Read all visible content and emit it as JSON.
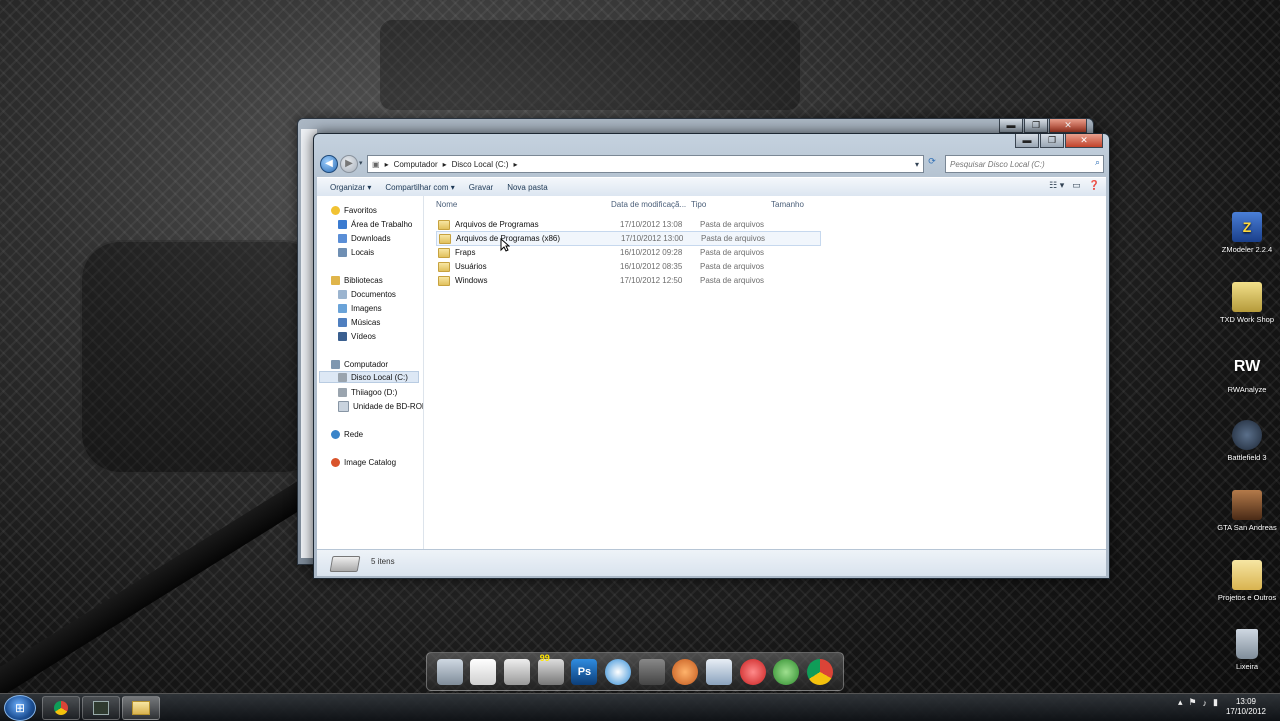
{
  "window": {
    "caption": {
      "minimize": "▬",
      "maximize": "❐",
      "close": "✕"
    }
  },
  "address": {
    "crumbs": [
      "Computador",
      "Disco Local (C:)"
    ],
    "separator": "▸"
  },
  "search": {
    "placeholder": "Pesquisar Disco Local (C:)"
  },
  "toolbar": {
    "organize": "Organizar ▾",
    "share": "Compartilhar com ▾",
    "burn": "Gravar",
    "new_folder": "Nova pasta"
  },
  "nav": {
    "favorites": "Favoritos",
    "fav_items": [
      "Área de Trabalho",
      "Downloads",
      "Locais"
    ],
    "libraries": "Bibliotecas",
    "lib_items": [
      "Documentos",
      "Imagens",
      "Músicas",
      "Vídeos"
    ],
    "computer": "Computador",
    "comp_items": [
      "Disco Local (C:)",
      "Thiiagoo (D:)",
      "Unidade de BD-ROM"
    ],
    "network": "Rede",
    "catalog": "Image Catalog"
  },
  "columns": {
    "name": "Nome",
    "date": "Data de modificaçã...",
    "type": "Tipo",
    "size": "Tamanho"
  },
  "files": [
    {
      "name": "Arquivos de Programas",
      "date": "17/10/2012 13:08",
      "type": "Pasta de arquivos"
    },
    {
      "name": "Arquivos de Programas (x86)",
      "date": "17/10/2012 13:00",
      "type": "Pasta de arquivos"
    },
    {
      "name": "Fraps",
      "date": "16/10/2012 09:28",
      "type": "Pasta de arquivos"
    },
    {
      "name": "Usuários",
      "date": "16/10/2012 08:35",
      "type": "Pasta de arquivos"
    },
    {
      "name": "Windows",
      "date": "17/10/2012 12:50",
      "type": "Pasta de arquivos"
    }
  ],
  "status": {
    "count": "5 itens"
  },
  "desktop_icons": [
    {
      "label": "ZModeler 2.2.4",
      "glyph": "Z"
    },
    {
      "label": "TXD Work Shop",
      "glyph": ""
    },
    {
      "label": "RWAnalyze",
      "glyph": "RW"
    },
    {
      "label": "Battlefield 3",
      "glyph": ""
    },
    {
      "label": "GTA San Andreas",
      "glyph": ""
    },
    {
      "label": "Projetos e Outros",
      "glyph": ""
    },
    {
      "label": "Lixeira",
      "glyph": ""
    }
  ],
  "dock": {
    "badge": "99",
    "ps": "Ps"
  },
  "clock": {
    "time": "13:09",
    "date": "17/10/2012"
  },
  "colors": {
    "accent": "#2f6fb6",
    "folder": "#e1c15d",
    "desktop": "#1a1a1a"
  }
}
